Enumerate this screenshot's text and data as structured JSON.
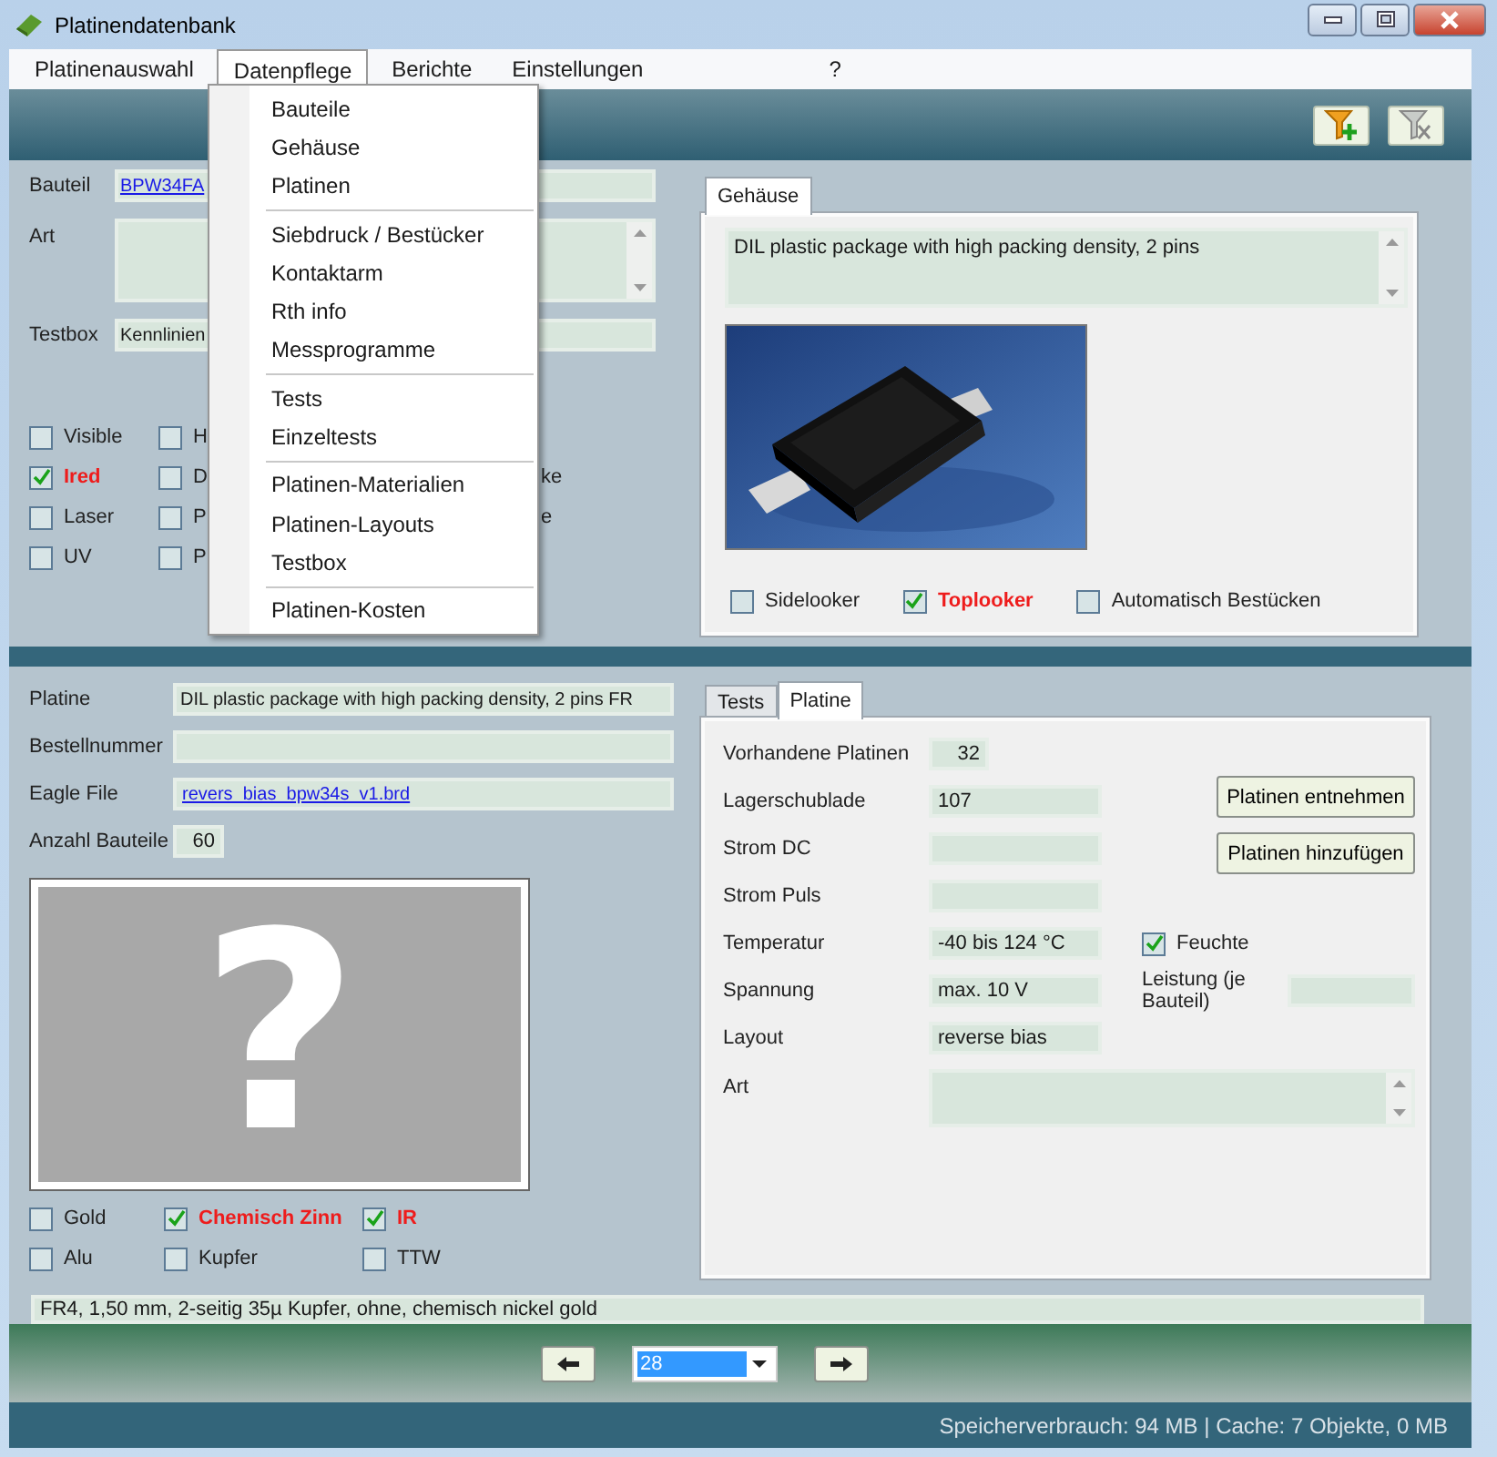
{
  "window": {
    "title": "Platinendatenbank"
  },
  "menu_bar": [
    {
      "label": "Platinenauswahl",
      "selected": false
    },
    {
      "label": "Datenpflege",
      "selected": true
    },
    {
      "label": "Berichte",
      "selected": false
    },
    {
      "label": "Einstellungen",
      "selected": false
    },
    {
      "label": "?",
      "selected": false
    }
  ],
  "open_menu": {
    "groups": [
      [
        "Bauteile",
        "Gehäuse",
        "Platinen"
      ],
      [
        "Siebdruck / Bestücker",
        "Kontaktarm",
        "Rth info",
        "Messprogramme"
      ],
      [
        "Tests",
        "Einzeltests"
      ],
      [
        "Platinen-Materialien",
        "Platinen-Layouts",
        "Testbox"
      ],
      [
        "Platinen-Kosten"
      ]
    ]
  },
  "bauteil": {
    "link_field": {
      "label": "Bauteil",
      "value": "BPW34FA"
    },
    "art": {
      "label": "Art"
    },
    "testbox": {
      "label": "Testbox",
      "value": "Kennlinien"
    },
    "checkbox_rows": [
      [
        {
          "kind": "checkbox",
          "label": "Visible",
          "checked": false,
          "highlight": false
        },
        {
          "kind": "checkbox",
          "label": "H",
          "checked": false,
          "highlight": false
        }
      ],
      [
        {
          "kind": "checkbox",
          "label": "Ired",
          "checked": true,
          "highlight": true
        },
        {
          "kind": "checkbox",
          "label": "D",
          "checked": false,
          "highlight": false
        },
        {
          "kind": "fragment",
          "label": "ke"
        }
      ],
      [
        {
          "kind": "checkbox",
          "label": "Laser",
          "checked": false,
          "highlight": false
        },
        {
          "kind": "checkbox",
          "label": "P",
          "checked": false,
          "highlight": false
        },
        {
          "kind": "fragment",
          "label": "e"
        }
      ],
      [
        {
          "kind": "checkbox",
          "label": "UV",
          "checked": false,
          "highlight": false
        },
        {
          "kind": "checkbox",
          "label": "P",
          "checked": false,
          "highlight": false
        }
      ]
    ]
  },
  "gehaeuse": {
    "tab": {
      "label": "Gehäuse",
      "selected": true
    },
    "description": "DIL plastic package with high packing density, 2 pins",
    "checkboxes": [
      {
        "label": "Sidelooker",
        "checked": false,
        "highlight": false
      },
      {
        "label": "Toplooker",
        "checked": true,
        "highlight": true
      },
      {
        "label": "Automatisch Bestücken",
        "checked": false,
        "highlight": false
      }
    ]
  },
  "platine": {
    "fields": [
      {
        "label": "Platine",
        "value": "DIL plastic package with high packing density, 2 pins FR",
        "kind": "text"
      },
      {
        "label": "Bestellnummer",
        "kind": "text"
      },
      {
        "label": "Eagle File",
        "value": "revers_bias_bpw34s_v1.brd",
        "kind": "link"
      },
      {
        "label": "Anzahl Bauteile",
        "value": "60",
        "kind": "number"
      }
    ],
    "placeholder_mark": "?",
    "checkbox_rows": [
      [
        {
          "label": "Gold",
          "checked": false,
          "highlight": false
        },
        {
          "label": "Chemisch Zinn",
          "checked": true,
          "highlight": true
        },
        {
          "label": "IR",
          "checked": true,
          "highlight": true
        }
      ],
      [
        {
          "label": "Alu",
          "checked": false,
          "highlight": false
        },
        {
          "label": "Kupfer",
          "checked": false,
          "highlight": false
        },
        {
          "label": "TTW",
          "checked": false,
          "highlight": false
        }
      ]
    ],
    "material": "FR4, 1,50 mm, 2-seitig 35µ Kupfer, ohne, chemisch nickel gold"
  },
  "details": {
    "tabs": [
      {
        "label": "Tests",
        "selected": false
      },
      {
        "label": "Platine",
        "selected": true
      }
    ],
    "fields": [
      {
        "label": "Vorhandene Platinen",
        "value": "32",
        "kind": "number"
      },
      {
        "label": "Lagerschublade",
        "value": "107",
        "kind": "text"
      },
      {
        "label": "Strom DC",
        "kind": "text"
      },
      {
        "label": "Strom Puls",
        "kind": "text"
      },
      {
        "label": "Temperatur",
        "value": "-40 bis 124 °C",
        "kind": "text"
      },
      {
        "label": "Spannung",
        "value": "max. 10 V",
        "kind": "text"
      },
      {
        "label": "Layout",
        "value": "reverse bias",
        "kind": "text"
      }
    ],
    "buttons": [
      "Platinen entnehmen",
      "Platinen hinzufügen"
    ],
    "feuchte": {
      "label": "Feuchte",
      "checked": true,
      "highlight": false
    },
    "leistung": {
      "label": "Leistung (je Bauteil)"
    },
    "art": {
      "label": "Art"
    }
  },
  "navigation": {
    "record": "28"
  },
  "status_bar": "Speicherverbrauch: 94 MB | Cache: 7 Objekte, 0 MB"
}
